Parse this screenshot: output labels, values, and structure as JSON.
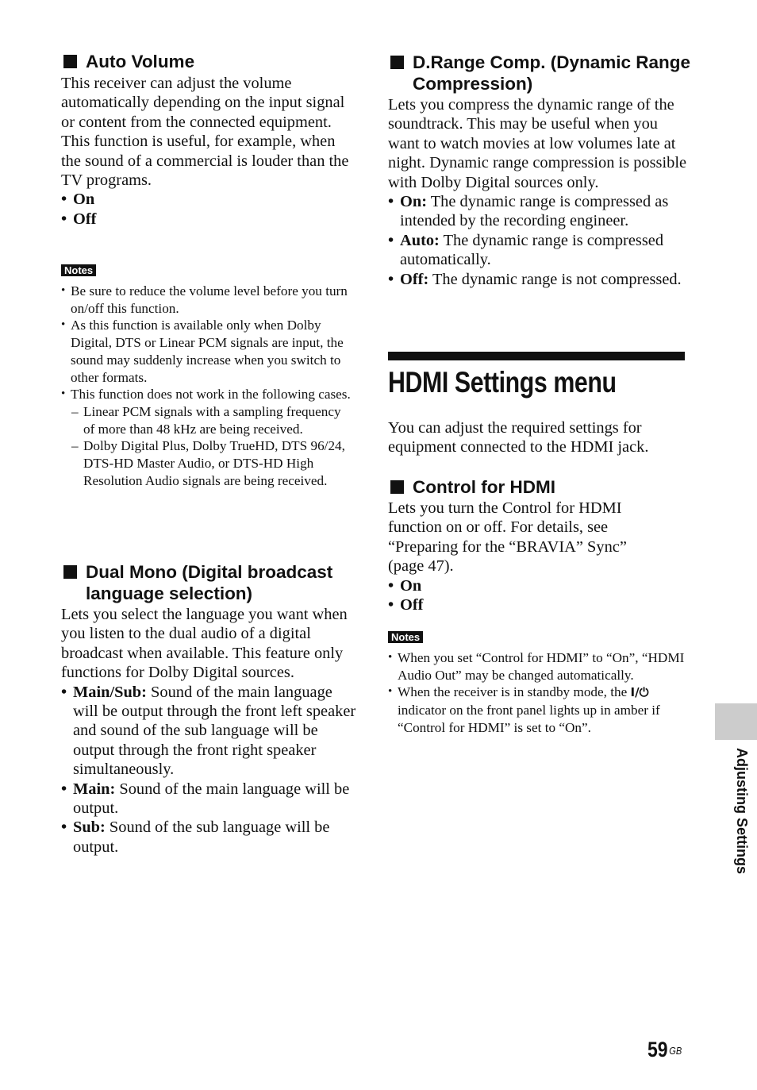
{
  "page": {
    "number": "59",
    "region_suffix": "GB",
    "side_tab_label": "Adjusting Settings"
  },
  "auto_volume": {
    "heading": "Auto Volume",
    "paragraphs": [
      "This receiver can adjust the volume automatically depending on the input signal or content from the connected equipment.",
      "This function is useful, for example, when the sound of a commercial is louder than the TV programs."
    ],
    "options": [
      "On",
      "Off"
    ],
    "notes_label": "Notes",
    "notes": [
      "Be sure to reduce the volume level before you turn on/off this function.",
      "As this function is available only when Dolby Digital, DTS or Linear PCM signals are input, the sound may suddenly increase when you switch to other formats.",
      "This function does not work in the following cases."
    ],
    "note_sub_items": [
      "Linear PCM signals with a sampling frequency of more than 48 kHz are being received.",
      "Dolby Digital Plus, Dolby TrueHD, DTS 96/24, DTS-HD Master Audio, or DTS-HD High Resolution Audio signals are being received."
    ]
  },
  "dual_mono": {
    "heading": "Dual Mono (Digital broadcast language selection)",
    "paragraph": "Lets you select the language you want when you listen to the dual audio of a digital broadcast when available. This feature only functions for Dolby Digital sources.",
    "options": [
      {
        "label": "Main/Sub:",
        "desc": " Sound of the main language will be output through the front left speaker and sound of the sub language will be output through the front right speaker simultaneously."
      },
      {
        "label": "Main:",
        "desc": " Sound of the main language will be output."
      },
      {
        "label": "Sub:",
        "desc": " Sound of the sub language will be output."
      }
    ]
  },
  "drange": {
    "heading": "D.Range Comp. (Dynamic Range Compression)",
    "paragraph": "Lets you compress the dynamic range of the soundtrack. This may be useful when you want to watch movies at low volumes late at night. Dynamic range compression is possible with Dolby Digital sources only.",
    "options": [
      {
        "label": "On:",
        "desc": " The dynamic range is compressed as intended by the recording engineer."
      },
      {
        "label": "Auto:",
        "desc": " The dynamic range is compressed automatically."
      },
      {
        "label": "Off:",
        "desc": " The dynamic range is not compressed."
      }
    ]
  },
  "hdmi_menu": {
    "title": "HDMI Settings menu",
    "intro": "You can adjust the required settings for equipment connected to the HDMI jack."
  },
  "control_hdmi": {
    "heading": "Control for HDMI",
    "paragraph": "Lets you turn the Control for HDMI function on or off. For details, see “Preparing for the “BRAVIA” Sync” (page 47).",
    "options": [
      "On",
      "Off"
    ],
    "notes_label": "Notes",
    "note1": "When you set “Control for HDMI” to “On”, “HDMI Audio Out” may be changed automatically.",
    "note2_before_icon": "When the receiver is in standby mode, the ",
    "power_icon_glyph": "I/⏻",
    "note2_after_icon": " indicator on the front panel lights up in amber if “Control for HDMI” is set to “On”."
  }
}
